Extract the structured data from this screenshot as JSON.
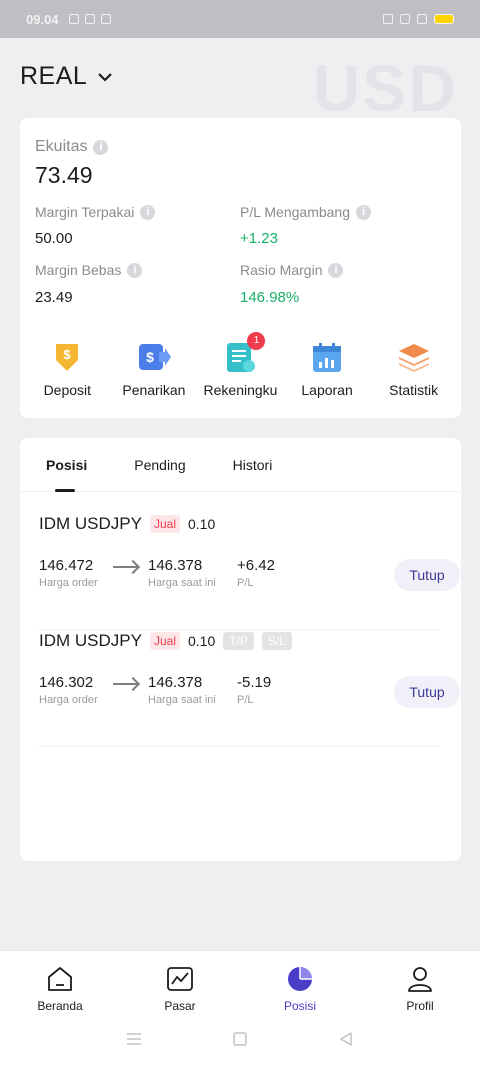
{
  "status_bar": {
    "time": "09.04"
  },
  "header": {
    "account_type": "REAL",
    "currency_watermark": "USD"
  },
  "summary": {
    "equity_label": "Ekuitas",
    "equity_value": "73.49",
    "used_margin_label": "Margin Terpakai",
    "used_margin_value": "50.00",
    "floating_pl_label": "P/L Mengambang",
    "floating_pl_value": "+1.23",
    "free_margin_label": "Margin Bebas",
    "free_margin_value": "23.49",
    "margin_ratio_label": "Rasio Margin",
    "margin_ratio_value": "146.98%"
  },
  "actions": [
    {
      "label": "Deposit",
      "icon": "deposit-icon"
    },
    {
      "label": "Penarikan",
      "icon": "withdraw-icon"
    },
    {
      "label": "Rekeningku",
      "icon": "accounts-icon",
      "badge": "1"
    },
    {
      "label": "Laporan",
      "icon": "report-icon"
    },
    {
      "label": "Statistik",
      "icon": "stats-icon"
    }
  ],
  "tabs": [
    {
      "label": "Posisi",
      "active": true
    },
    {
      "label": "Pending",
      "active": false
    },
    {
      "label": "Histori",
      "active": false
    }
  ],
  "positions": [
    {
      "symbol": "IDM USDJPY",
      "side": "Jual",
      "lot": "0.10",
      "order_price": "146.472",
      "order_price_label": "Harga order",
      "current_price": "146.378",
      "current_price_label": "Harga saat ini",
      "pl": "+6.42",
      "pl_label": "P/L",
      "close_label": "Tutup"
    },
    {
      "symbol": "IDM USDJPY",
      "side": "Jual",
      "lot": "0.10",
      "tp_tag": "T/P",
      "sl_tag": "S/L",
      "order_price": "146.302",
      "order_price_label": "Harga order",
      "current_price": "146.378",
      "current_price_label": "Harga saat ini",
      "pl": "-5.19",
      "pl_label": "P/L",
      "close_label": "Tutup"
    }
  ],
  "bottom_nav": [
    {
      "label": "Beranda",
      "icon": "home-icon",
      "active": false
    },
    {
      "label": "Pasar",
      "icon": "market-chart-icon",
      "active": false
    },
    {
      "label": "Posisi",
      "icon": "pie-chart-icon",
      "active": true
    },
    {
      "label": "Profil",
      "icon": "profile-icon",
      "active": false
    }
  ],
  "colors": {
    "accent": "#4a3ec9",
    "profit": "#17b26a",
    "loss": "#ef3b4d"
  }
}
